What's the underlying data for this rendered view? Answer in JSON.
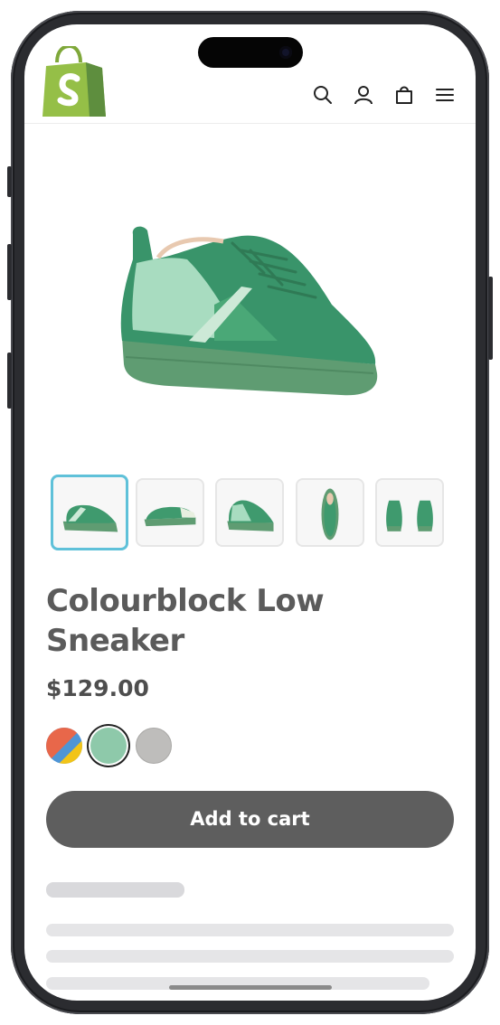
{
  "app": {
    "logo": "shopify-bag-logo"
  },
  "header": {
    "icons": [
      "search-icon",
      "account-icon",
      "cart-bag-icon",
      "menu-icon"
    ]
  },
  "product": {
    "title": "Colourblock Low Sneaker",
    "price": "$129.00",
    "thumbnails": [
      {
        "view": "side",
        "selected": true
      },
      {
        "view": "profile"
      },
      {
        "view": "angle"
      },
      {
        "view": "top"
      },
      {
        "view": "pair"
      }
    ],
    "swatches": [
      {
        "name": "multicolor",
        "colors": [
          "#e8674a",
          "#4f95d6",
          "#f2c418"
        ],
        "selected": false
      },
      {
        "name": "green",
        "colors": [
          "#8ec9aa"
        ],
        "selected": true
      },
      {
        "name": "grey",
        "colors": [
          "#bebdbb"
        ],
        "selected": false
      }
    ],
    "add_to_cart_label": "Add to cart"
  },
  "colors": {
    "brand_green": "#95bf47",
    "button": "#5e5e5e",
    "selected_thumb": "#5fc1d9",
    "skeleton": "#e5e5e7"
  }
}
